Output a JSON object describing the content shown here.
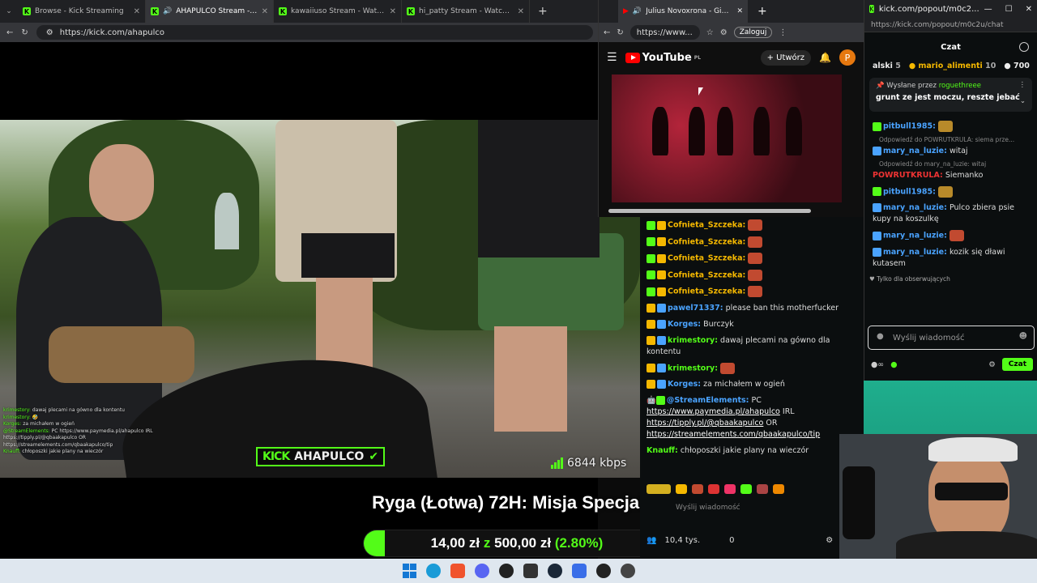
{
  "main_browser": {
    "tabs": [
      {
        "title": "Browse - Kick Streaming",
        "active": false
      },
      {
        "title": "AHAPULCO Stream - Watch Live",
        "active": true
      },
      {
        "title": "kawaiiuso Stream - Watch Live on",
        "active": false
      },
      {
        "title": "hi_patty Stream - Watch Live on K",
        "active": false
      }
    ],
    "url": "https://kick.com/ahapulco"
  },
  "video": {
    "overlay_chat": [
      {
        "name": "krimestory:",
        "text": "dawaj plecami na gówno dla kontentu"
      },
      {
        "name": "krimestory:",
        "text": "🤣"
      },
      {
        "name": "Korges:",
        "text": "za michałem w ogień"
      },
      {
        "name": "@StreamElements:",
        "text": "PC https://www.paymedia.pl/ahapulco IRL https://tipply.pl/@qbaakapulco OR https://streamelements.com/qbaakapulco/tip"
      },
      {
        "name": "Knauff:",
        "text": "chłoposzki jakie plany na wieczór"
      }
    ],
    "kick_label": "KICK",
    "channel_label": "AHAPULCO",
    "bitrate": "6844 kbps",
    "banner_title": "Ryga (Łotwa) 72H: Misja Specjalna",
    "goal": {
      "current": "14,00 zł",
      "sep": "z",
      "target": "500,00 zł",
      "percent_text": "(2.80%)",
      "fraction": 0.028
    }
  },
  "youtube": {
    "tab_title": "Julius Novoxrona - Giv Me Ki",
    "url": "https://www...",
    "login_label": "Zaloguj",
    "logo_text": "YouTube",
    "region": "PL",
    "create_label": "Utwórz",
    "avatar_letter": "P"
  },
  "kick_chat": {
    "messages": [
      {
        "name": "Cofnieta_Szczeka:",
        "color": "#f5b800",
        "text": ""
      },
      {
        "name": "Cofnieta_Szczeka:",
        "color": "#f5b800",
        "text": ""
      },
      {
        "name": "Cofnieta_Szczeka:",
        "color": "#f5b800",
        "text": ""
      },
      {
        "name": "Cofnieta_Szczeka:",
        "color": "#f5b800",
        "text": ""
      },
      {
        "name": "Cofnieta_Szczeka:",
        "color": "#f5b800",
        "text": ""
      },
      {
        "name": "pawel71337:",
        "color": "#4aa3ff",
        "text": "please ban this motherfucker"
      },
      {
        "name": "Korges:",
        "color": "#4aa3ff",
        "text": "Burczyk"
      },
      {
        "name": "krimestory:",
        "color": "#53fc18",
        "text": "dawaj plecami na gówno dla kontentu"
      },
      {
        "name": "krimestory:",
        "color": "#53fc18",
        "text": ""
      },
      {
        "name": "Korges:",
        "color": "#4aa3ff",
        "text": "za michałem w ogień"
      }
    ],
    "bot_message": {
      "name": "@StreamElements:",
      "text": "PC",
      "link1": "https://www.paymedia.pl/ahapulco",
      "after1": "IRL",
      "link2": "https://tipply.pl/@qbaakapulco",
      "after2": "OR",
      "link3": "https://streamelements.com/qbaakapulco/tip"
    },
    "last": {
      "name": "Knauff:",
      "text": "chłoposzki jakie plany na wieczór"
    },
    "input_placeholder": "Wyślij wiadomość",
    "viewers": "10,4 tys.",
    "count": "0",
    "send_label": "Cz"
  },
  "popout": {
    "window_title": "kick.com/popout/m0c2...",
    "url": "https://kick.com/popout/m0c2u/chat",
    "header": "Czat",
    "leaderboard": [
      {
        "name": "alski",
        "count": "5"
      },
      {
        "name": "mario_alimenti",
        "count": "10"
      },
      {
        "name": "",
        "count": "700"
      }
    ],
    "pinned": {
      "prefix": "Wysłane przez",
      "by": "roguethreee",
      "text": "grunt ze jest moczu, reszte jebać"
    },
    "messages": [
      {
        "reply": "",
        "name": "pitbull1985:",
        "color": "#4aa3ff",
        "text": ""
      },
      {
        "reply": "Odpowiedź do POWRUTKRULA: siema prze...",
        "name": "mary_na_luzie:",
        "color": "#4aa3ff",
        "text": "witaj"
      },
      {
        "reply": "Odpowiedź do mary_na_luzie: witaj",
        "name": "POWRUTKRULA:",
        "color": "#e33",
        "text": "Siemanko"
      },
      {
        "reply": "",
        "name": "pitbull1985:",
        "color": "#4aa3ff",
        "text": ""
      },
      {
        "reply": "",
        "name": "mary_na_luzie:",
        "color": "#4aa3ff",
        "text": "Pulco zbiera psie kupy na koszulkę"
      },
      {
        "reply": "",
        "name": "mary_na_luzie:",
        "color": "#4aa3ff",
        "text": ""
      },
      {
        "reply": "",
        "name": "mary_na_luzie:",
        "color": "#4aa3ff",
        "text": "kozik się dławi kutasem"
      }
    ],
    "follow_only": "Tylko dla obserwujących",
    "input_placeholder": "Wyślij wiadomość",
    "send_label": "Czat"
  }
}
